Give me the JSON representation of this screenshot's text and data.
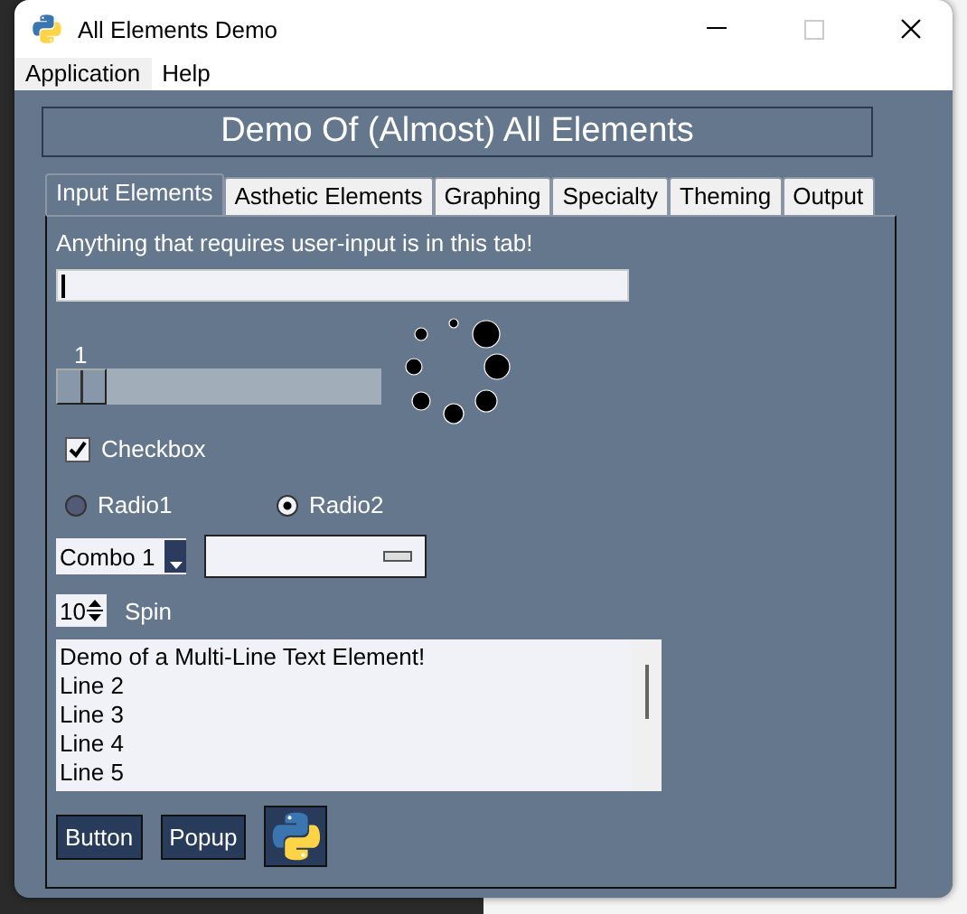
{
  "window": {
    "title": "All Elements Demo"
  },
  "menu": [
    {
      "label": "Application",
      "selected": true
    },
    {
      "label": "Help",
      "selected": false
    }
  ],
  "heading": "Demo Of (Almost) All Elements",
  "tabs": [
    {
      "label": "Input Elements",
      "selected": true
    },
    {
      "label": "Asthetic Elements",
      "selected": false
    },
    {
      "label": "Graphing",
      "selected": false
    },
    {
      "label": "Specialty",
      "selected": false
    },
    {
      "label": "Theming",
      "selected": false
    },
    {
      "label": "Output",
      "selected": false
    }
  ],
  "intro": "Anything that requires user-input is in this tab!",
  "slider": {
    "reading": "1",
    "level": 0
  },
  "checkbox": {
    "label": "Checkbox",
    "checked": true
  },
  "radios": [
    {
      "label": "Radio1",
      "selected": false
    },
    {
      "label": "Radio2",
      "selected": true
    }
  ],
  "combo": {
    "value": "Combo 1"
  },
  "spin": {
    "value": "10",
    "label": "Spin"
  },
  "multiline": [
    "Demo of a Multi-Line Text Element!",
    "Line 2",
    "Line 3",
    "Line 4",
    "Line 5"
  ],
  "buttons": [
    "Button",
    "Popup"
  ]
}
